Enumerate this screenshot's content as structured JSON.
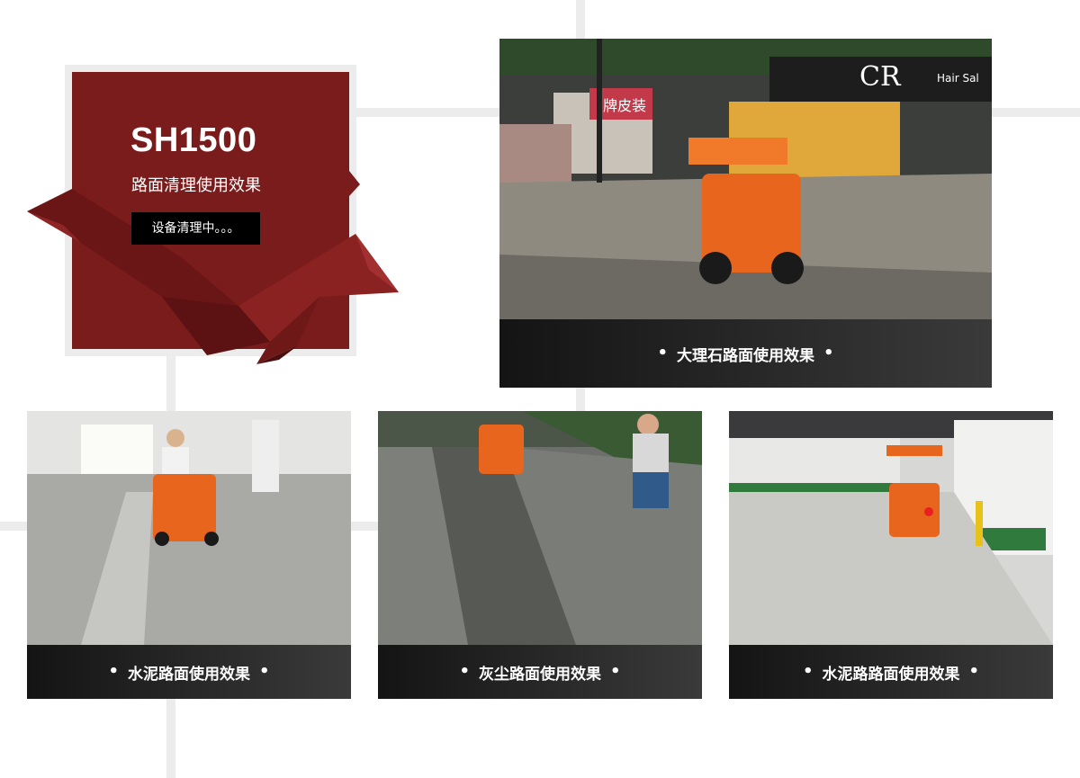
{
  "hero": {
    "title": "SH1500",
    "subtitle": "路面清理使用效果",
    "status_button": "设备清理中。。。",
    "color": "#7a1c1c"
  },
  "cards": [
    {
      "caption": "大理石路面使用效果",
      "bullet": "•"
    },
    {
      "caption": "水泥路面使用效果",
      "bullet": "•"
    },
    {
      "caption": "灰尘路面使用效果",
      "bullet": "•"
    },
    {
      "caption": "水泥路路面使用效果",
      "bullet": "•"
    }
  ],
  "photo1_signs": {
    "shop": "牌皮装",
    "brand": "CR",
    "salon": "Hair Sal"
  }
}
